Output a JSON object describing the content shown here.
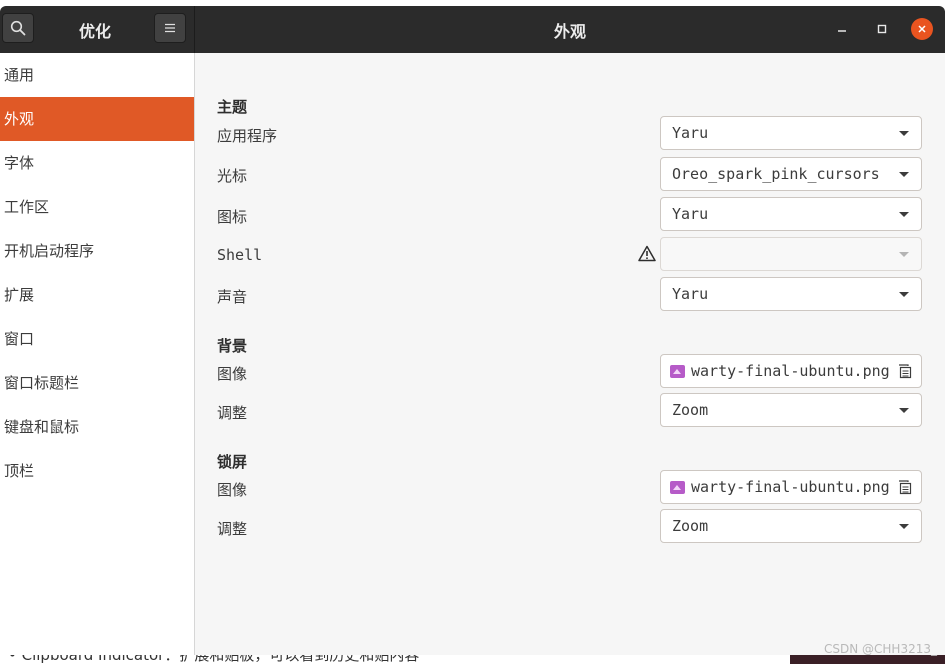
{
  "background": {
    "bottom_text": "• Clipboard Indicator：扩展和贴板，可以看到历史和贴内容",
    "watermark": "CSDN @CHH3213_"
  },
  "header": {
    "app_title": "优化",
    "page_title": "外观",
    "close_color": "#e95420"
  },
  "sidebar": {
    "items": [
      {
        "label": "通用"
      },
      {
        "label": "外观"
      },
      {
        "label": "字体"
      },
      {
        "label": "工作区"
      },
      {
        "label": "开机启动程序"
      },
      {
        "label": "扩展"
      },
      {
        "label": "窗口"
      },
      {
        "label": "窗口标题栏"
      },
      {
        "label": "键盘和鼠标"
      },
      {
        "label": "顶栏"
      }
    ],
    "active_index": 1,
    "active_color": "#e05926"
  },
  "main": {
    "theme": {
      "title": "主题",
      "applications": {
        "label": "应用程序",
        "value": "Yaru"
      },
      "cursor": {
        "label": "光标",
        "value": "Oreo_spark_pink_cursors"
      },
      "icons": {
        "label": "图标",
        "value": "Yaru"
      },
      "shell": {
        "label": "Shell",
        "value": ""
      },
      "sound": {
        "label": "声音",
        "value": "Yaru"
      }
    },
    "background": {
      "title": "背景",
      "image": {
        "label": "图像",
        "value": "warty-final-ubuntu.png"
      },
      "adjust": {
        "label": "调整",
        "value": "Zoom"
      }
    },
    "lockscreen": {
      "title": "锁屏",
      "image": {
        "label": "图像",
        "value": "warty-final-ubuntu.png"
      },
      "adjust": {
        "label": "调整",
        "value": "Zoom"
      }
    }
  }
}
